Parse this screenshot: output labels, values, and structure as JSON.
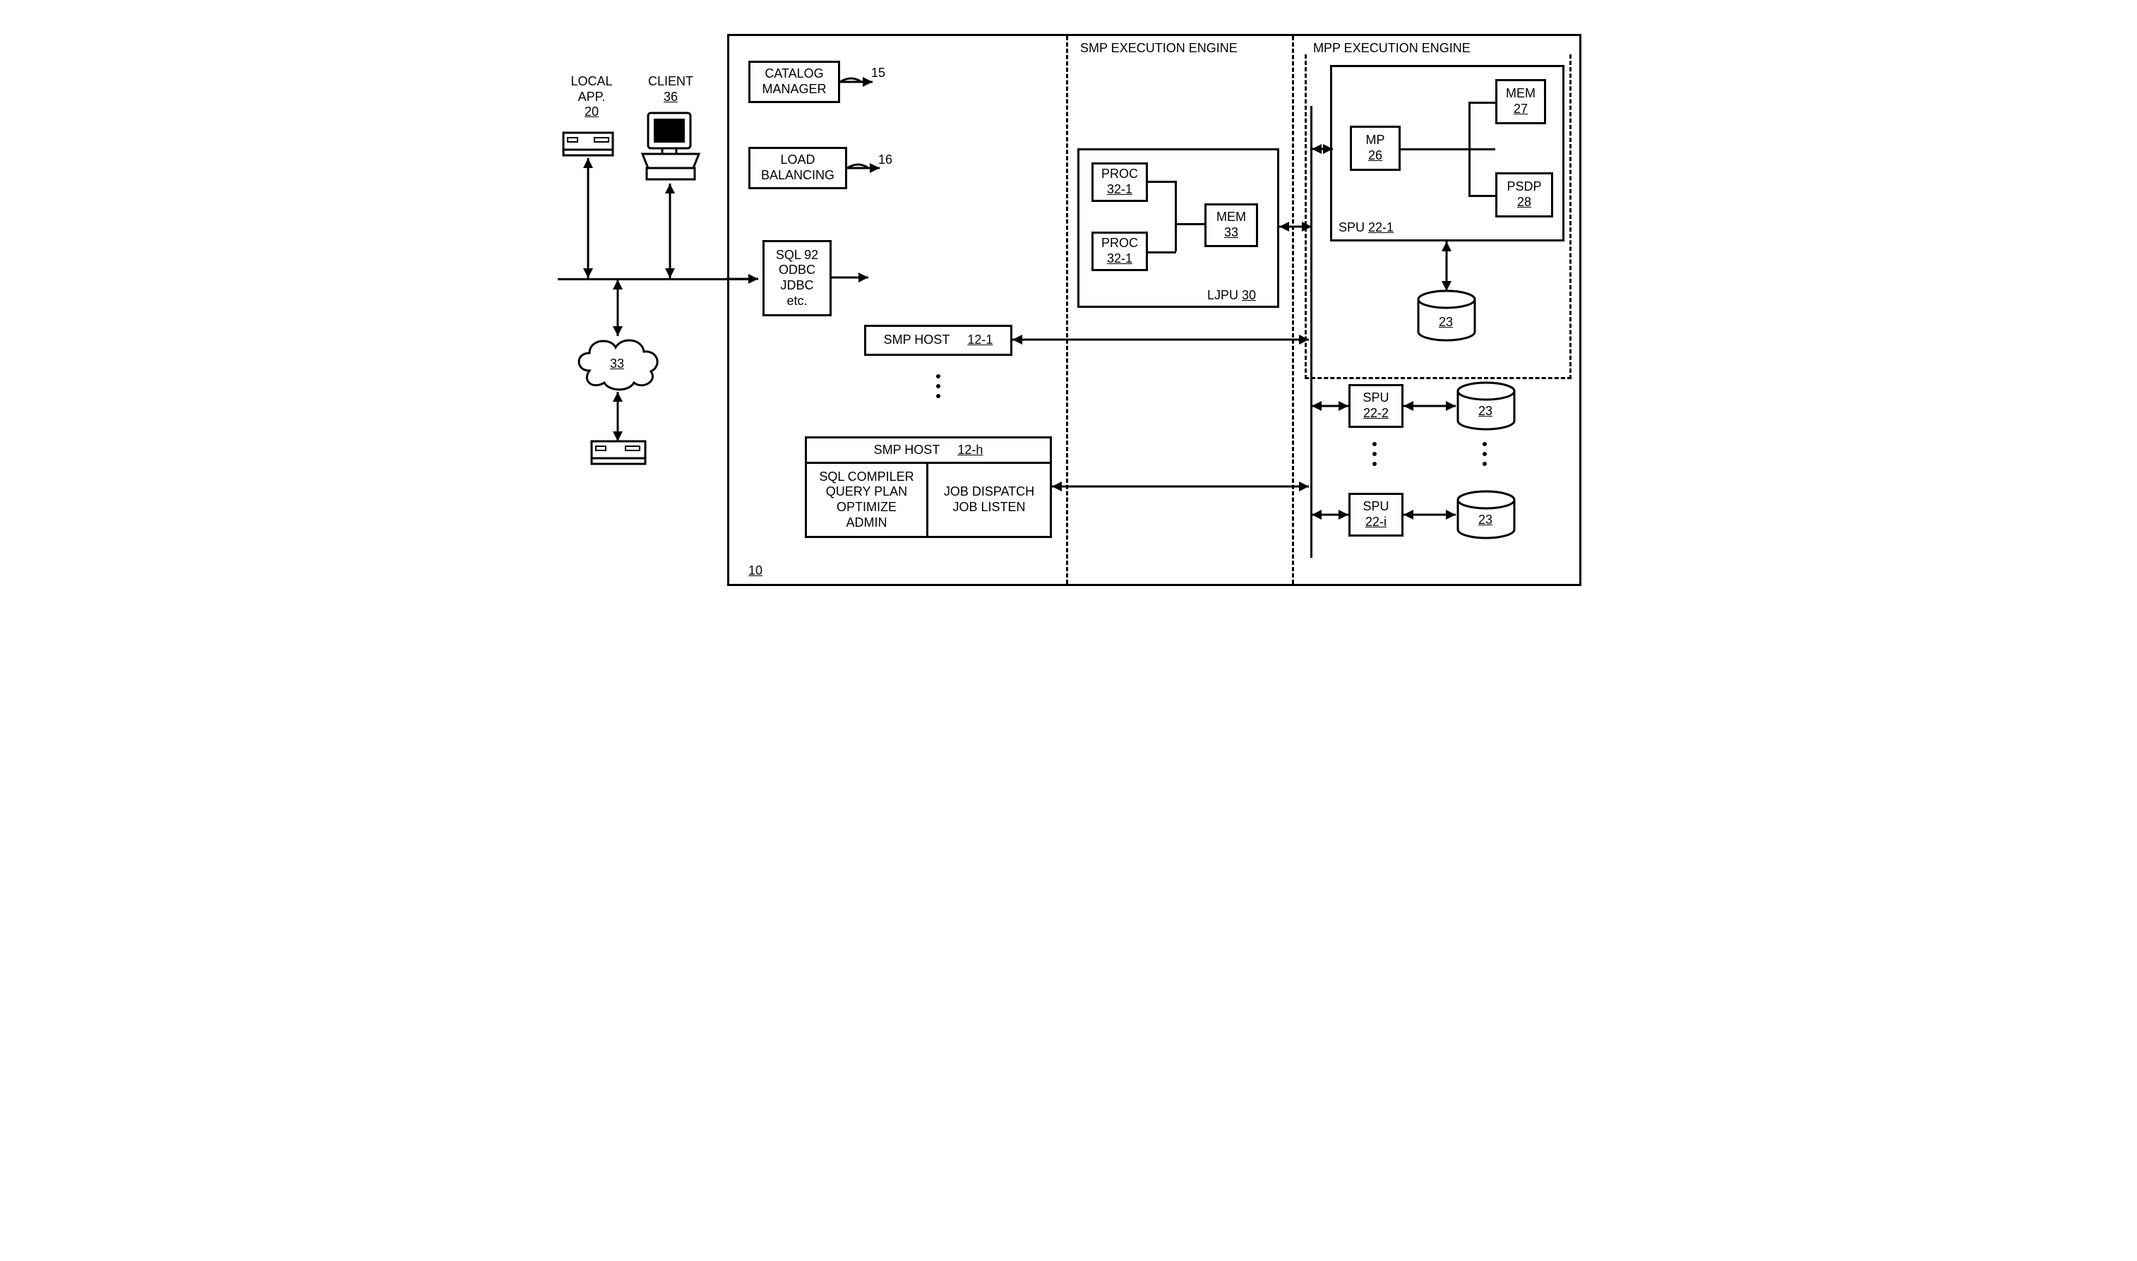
{
  "localapp": {
    "title": "LOCAL\nAPP.",
    "id": "20"
  },
  "client": {
    "title": "CLIENT",
    "id": "36"
  },
  "cloud": {
    "id": "33"
  },
  "catalog": {
    "title": "CATALOG\nMANAGER",
    "ref": "15"
  },
  "load": {
    "title": "LOAD\nBALANCING",
    "ref": "16"
  },
  "sql": {
    "text": "SQL 92\nODBC\nJDBC\netc."
  },
  "smp1": {
    "title": "SMP HOST",
    "id": "12-1"
  },
  "smph": {
    "title": "SMP HOST",
    "id": "12-h"
  },
  "smph_left": "SQL COMPILER\nQUERY PLAN\nOPTIMIZE\nADMIN",
  "smph_right": "JOB DISPATCH\nJOB LISTEN",
  "smp_engine": "SMP EXECUTION ENGINE",
  "mpp_engine": "MPP EXECUTION ENGINE",
  "ljpu": {
    "title": "LJPU",
    "id": "30"
  },
  "proc1": {
    "title": "PROC",
    "id": "32-1"
  },
  "proc2": {
    "title": "PROC",
    "id": "32-1"
  },
  "mem33": {
    "title": "MEM",
    "id": "33"
  },
  "spu1": {
    "title": "SPU",
    "id": "22-1"
  },
  "mp": {
    "title": "MP",
    "id": "26"
  },
  "mem27": {
    "title": "MEM",
    "id": "27"
  },
  "psdp": {
    "title": "PSDP",
    "id": "28"
  },
  "cyl": {
    "id": "23"
  },
  "spu2": {
    "title": "SPU",
    "id": "22-2"
  },
  "spui": {
    "title": "SPU",
    "id": "22-i"
  },
  "mainref": "10"
}
